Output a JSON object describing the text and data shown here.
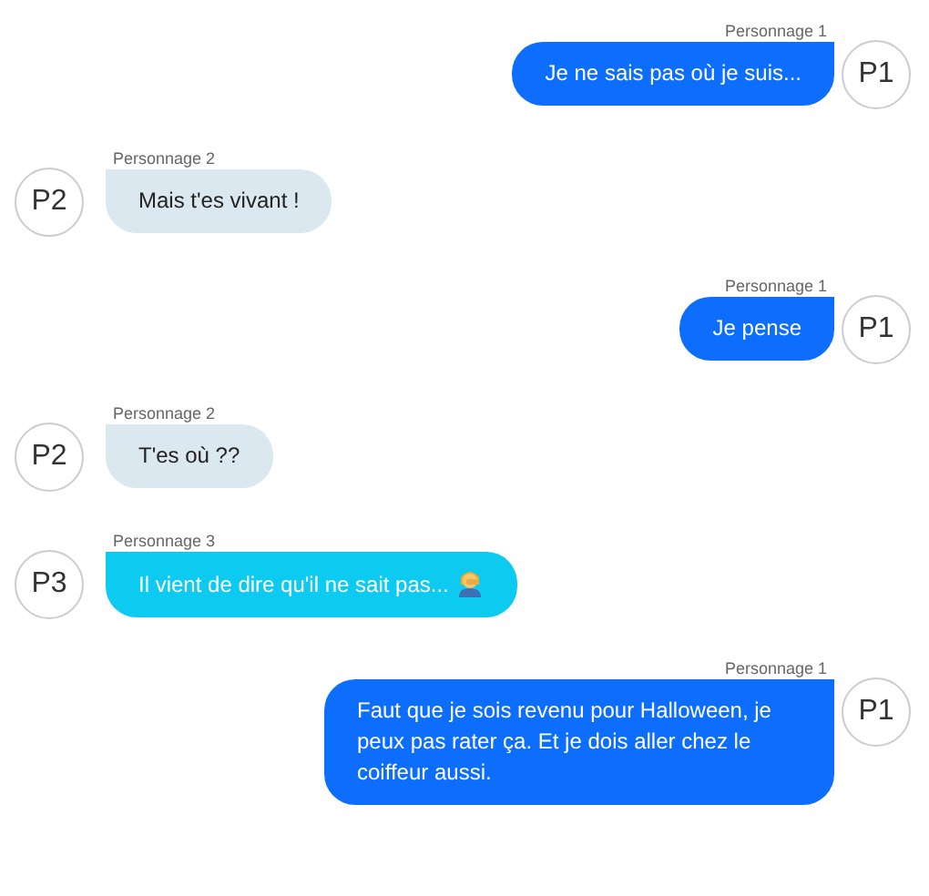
{
  "messages": [
    {
      "kind": "sent",
      "author": "Personnage 1",
      "avatar": "P1",
      "text": "Je ne sais pas où je suis...",
      "color": "#0d6efd"
    },
    {
      "kind": "received",
      "author": "Personnage 2",
      "avatar": "P2",
      "text": "Mais t'es vivant !",
      "color": "#dce8ef"
    },
    {
      "kind": "sent",
      "author": "Personnage 1",
      "avatar": "P1",
      "text": "Je pense",
      "color": "#0d6efd"
    },
    {
      "kind": "received",
      "author": "Personnage 2",
      "avatar": "P2",
      "text": "T'es où ??",
      "color": "#dce8ef"
    },
    {
      "kind": "reaction",
      "author": "Personnage 3",
      "avatar": "P3",
      "text": "Il vient de dire qu'il ne sait pas...",
      "color": "#0dcaf0"
    },
    {
      "kind": "sent",
      "author": "Personnage 1",
      "avatar": "P1",
      "text": "Faut que je sois revenu pour Halloween, je peux pas rater ça. Et je dois aller chez le coiffeur aussi.",
      "color": "#0d6efd"
    }
  ]
}
